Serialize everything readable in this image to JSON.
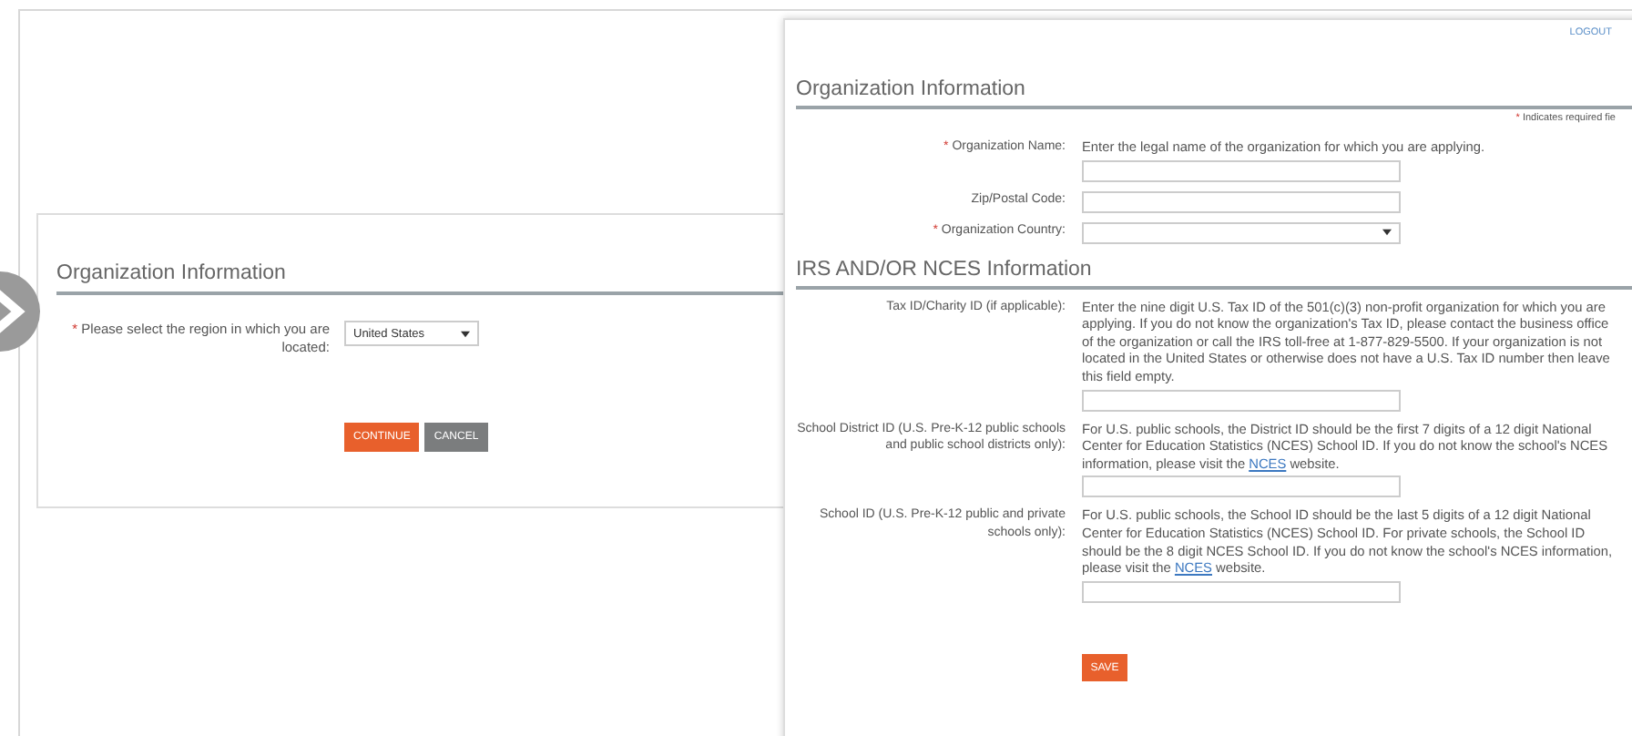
{
  "region_window": {
    "title": "Organization Information",
    "fields": [
      {
        "mark": "*",
        "label": "Please select the region in which you are located:",
        "kind": "select",
        "value": "United States"
      }
    ],
    "buttons": [
      {
        "label": "CONTINUE",
        "kind": "primary"
      },
      {
        "label": "CANCEL",
        "kind": "secondary"
      }
    ]
  },
  "org_window": {
    "logout": "LOGOUT",
    "title": "Organization Information",
    "required_note": {
      "mark": "*",
      "text": "Indicates required fie"
    },
    "fields": [
      {
        "mark": "*",
        "label": "Organization Name:",
        "kind": "text",
        "help": [
          {
            "text": "Enter the legal name of the organization for which you are applying."
          }
        ]
      },
      {
        "label": "Zip/Postal Code:",
        "kind": "text"
      },
      {
        "mark": "*",
        "label": "Organization Country:",
        "kind": "select"
      }
    ],
    "section": "IRS AND/OR NCES Information",
    "section_fields": [
      {
        "label": "Tax ID/Charity ID (if applicable):",
        "kind": "text",
        "help": [
          {
            "text": "Enter the nine digit U.S. Tax ID of the 501(c)(3) non-profit organization for which you are applying. If you do not know the organization's Tax ID, please contact the business office of the organization or call the IRS toll-free at 1-877-829-5500. If your organization is not located in the United States or otherwise does not have a U.S. Tax ID number then leave this field empty."
          }
        ]
      },
      {
        "label": "School District ID (U.S. Pre-K-12 public schools and public school districts only):",
        "kind": "text",
        "help": [
          {
            "text": "For U.S. public schools, the District ID should be the first 7 digits of a 12 digit National Center for Education Statistics (NCES) School ID. If you do not know the school's NCES information, please visit the "
          },
          {
            "text": "NCES",
            "link": true
          },
          {
            "text": " website."
          }
        ]
      },
      {
        "label": "School ID (U.S. Pre-K-12 public and private schools only):",
        "kind": "text",
        "help": [
          {
            "text": "For U.S. public schools, the School ID should be the last 5 digits of a 12 digit National Center for Education Statistics (NCES) School ID. For private schools, the School ID should be the 8 digit NCES School ID. If you do not know the school's NCES information, please visit the "
          },
          {
            "text": "NCES",
            "link": true
          },
          {
            "text": " website."
          }
        ]
      }
    ],
    "save": "SAVE"
  }
}
